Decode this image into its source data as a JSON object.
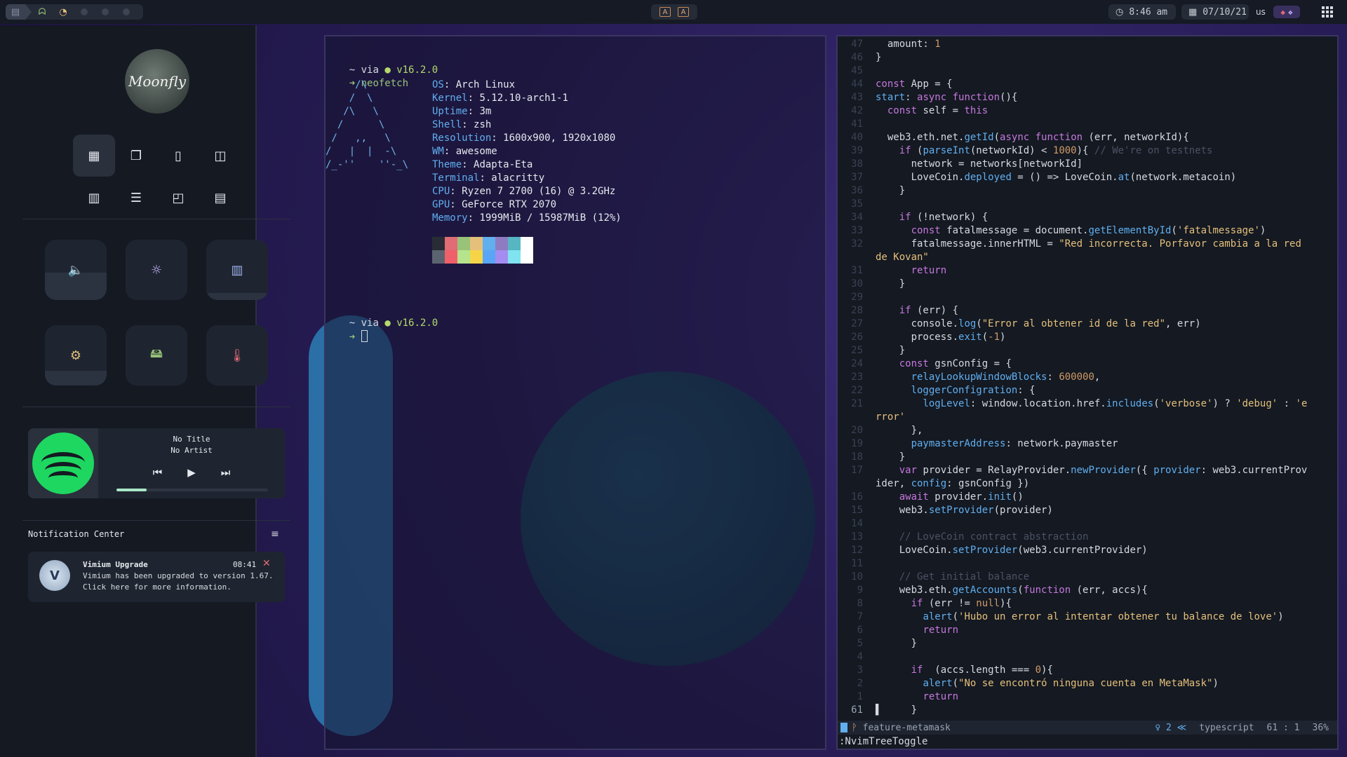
{
  "topbar": {
    "time": "8:46 am",
    "date": "07/10/21",
    "keyboard_layout": "us"
  },
  "sidebar": {
    "avatar_text": "Moonfly",
    "layouts": [
      "tile",
      "floating",
      "max",
      "fair",
      "columns",
      "rows",
      "spiral",
      "dwindle"
    ],
    "tiles": [
      {
        "name": "volume",
        "level": 0.45,
        "icon": "🔈"
      },
      {
        "name": "brightness",
        "level": 0.0,
        "icon": "☼"
      },
      {
        "name": "memory",
        "level": 0.12,
        "icon": "▥"
      },
      {
        "name": "cpu",
        "level": 0.25,
        "icon": "⚙"
      },
      {
        "name": "disk",
        "level": 0.0,
        "icon": "🖴"
      },
      {
        "name": "temperature",
        "level": 0.0,
        "icon": "🌡"
      }
    ],
    "music": {
      "title": "No Title",
      "artist": "No Artist",
      "progress": 0.2
    },
    "notifications": {
      "header": "Notification Center",
      "items": [
        {
          "title": "Vimium Upgrade",
          "time": "08:41",
          "body_line1": "Vimium has been upgraded to version 1.67.",
          "body_line2": "Click here for more information."
        }
      ]
    }
  },
  "terminal": {
    "prompt1_dir": "~",
    "prompt1_via": "via",
    "node_version": "v16.2.0",
    "command": "neofetch",
    "ascii_art": "     /\\\n    /  \\\n   /\\   \\\n  /      \\\n /   ,,   \\\n/   |  |  -\\\n/_-''    ''-_\\",
    "info": [
      {
        "key": "OS",
        "value": "Arch Linux"
      },
      {
        "key": "Kernel",
        "value": "5.12.10-arch1-1"
      },
      {
        "key": "Uptime",
        "value": "3m"
      },
      {
        "key": "Shell",
        "value": "zsh"
      },
      {
        "key": "Resolution",
        "value": "1600x900, 1920x1080"
      },
      {
        "key": "WM",
        "value": "awesome"
      },
      {
        "key": "Theme",
        "value": "Adapta-Eta"
      },
      {
        "key": "Terminal",
        "value": "alacritty"
      },
      {
        "key": "CPU",
        "value": "Ryzen 7 2700 (16) @ 3.2GHz"
      },
      {
        "key": "GPU",
        "value": "GeForce RTX 2070"
      },
      {
        "key": "Memory",
        "value": "1999MiB / 15987MiB (12%)"
      }
    ],
    "palette_top": [
      "#282c34",
      "#e06c75",
      "#98c379",
      "#e5c07b",
      "#61afef",
      "#8e7cc3",
      "#56b6c2",
      "#ffffff"
    ],
    "palette_bottom": [
      "#5c6370",
      "#f0606a",
      "#b5e48c",
      "#f5d547",
      "#58a6f5",
      "#a48cf0",
      "#7fe3f0",
      "#ffffff"
    ]
  },
  "editor": {
    "lines": [
      {
        "n": "47",
        "t": "  amount: <n>1</n>"
      },
      {
        "n": "46",
        "t": "}"
      },
      {
        "n": "45",
        "t": ""
      },
      {
        "n": "44",
        "t": "<k>const</k> App = {"
      },
      {
        "n": "43",
        "t": "<f>start</f>: <k>async</k> <k>function</k>(){"
      },
      {
        "n": "42",
        "t": "  <k>const</k> self = <k>this</k>"
      },
      {
        "n": "41",
        "t": ""
      },
      {
        "n": "40",
        "t": "  web3.eth.net.<f>getId</f>(<k>async</k> <k>function</k> (err, networkId){"
      },
      {
        "n": "39",
        "t": "    <k>if</k> (<f>parseInt</f>(networkId) < <n>1000</n>){ <c>// We're on testnets</c>"
      },
      {
        "n": "38",
        "t": "      network = networks[networkId]"
      },
      {
        "n": "37",
        "t": "      LoveCoin.<f>deployed</f> = () => LoveCoin.<f>at</f>(network.metacoin)"
      },
      {
        "n": "36",
        "t": "    }"
      },
      {
        "n": "35",
        "t": ""
      },
      {
        "n": "34",
        "t": "    <k>if</k> (!network) {"
      },
      {
        "n": "33",
        "t": "      <k>const</k> fatalmessage = document.<f>getElementById</f>(<s>'fatalmessage'</s>)"
      },
      {
        "n": "32",
        "t": "      fatalmessage.innerHTML = <s>\"Red incorrecta. Porfavor cambia a la red</s>"
      },
      {
        "n": "",
        "t": "<s>de Kovan\"</s>",
        "cont": true
      },
      {
        "n": "31",
        "t": "      <k>return</k>"
      },
      {
        "n": "30",
        "t": "    }"
      },
      {
        "n": "29",
        "t": ""
      },
      {
        "n": "28",
        "t": "    <k>if</k> (err) {"
      },
      {
        "n": "27",
        "t": "      console.<f>log</f>(<s>\"Error al obtener id de la red\"</s>, err)"
      },
      {
        "n": "26",
        "t": "      process.<f>exit</f>(<n>-1</n>)"
      },
      {
        "n": "25",
        "t": "    }"
      },
      {
        "n": "24",
        "t": "    <k>const</k> gsnConfig = {"
      },
      {
        "n": "23",
        "t": "      <f>relayLookupWindowBlocks</f>: <n>600000</n>,"
      },
      {
        "n": "22",
        "t": "      <f>loggerConfigration</f>: {"
      },
      {
        "n": "21",
        "t": "        <f>logLevel</f>: window.location.href.<f>includes</f>(<s>'verbose'</s>) ? <s>'debug'</s> : <s>'e</s>"
      },
      {
        "n": "",
        "t": "<s>rror'</s>",
        "cont": true
      },
      {
        "n": "20",
        "t": "      },"
      },
      {
        "n": "19",
        "t": "      <f>paymasterAddress</f>: network.paymaster"
      },
      {
        "n": "18",
        "t": "    }"
      },
      {
        "n": "17",
        "t": "    <k>var</k> provider = RelayProvider.<f>newProvider</f>({ <f>provider</f>: web3.currentProv"
      },
      {
        "n": "",
        "t": "ider, <f>config</f>: gsnConfig })",
        "cont": true
      },
      {
        "n": "16",
        "t": "    <k>await</k> provider.<f>init</f>()"
      },
      {
        "n": "15",
        "t": "    web3.<f>setProvider</f>(provider)"
      },
      {
        "n": "14",
        "t": ""
      },
      {
        "n": "13",
        "t": "    <c>// LoveCoin contract abstraction</c>"
      },
      {
        "n": "12",
        "t": "    LoveCoin.<f>setProvider</f>(web3.currentProvider)"
      },
      {
        "n": "11",
        "t": ""
      },
      {
        "n": "10",
        "t": "    <c>// Get initial balance</c>"
      },
      {
        "n": "9",
        "t": "    web3.eth.<f>getAccounts</f>(<k>function</k> (err, accs){"
      },
      {
        "n": "8",
        "t": "      <k>if</k> (err != <n>null</n>){"
      },
      {
        "n": "7",
        "t": "        <f>alert</f>(<s>'Hubo un error al intentar obtener tu balance de love'</s>)"
      },
      {
        "n": "6",
        "t": "        <k>return</k>"
      },
      {
        "n": "5",
        "t": "      }"
      },
      {
        "n": "4",
        "t": ""
      },
      {
        "n": "3",
        "t": "      <k>if</k>  (accs.length === <n>0</n>){"
      },
      {
        "n": "2",
        "t": "        <f>alert</f>(<s>\"No se encontró ninguna cuenta en MetaMask\"</s>)"
      },
      {
        "n": "1",
        "t": "        <k>return</k>"
      },
      {
        "n": "61",
        "t": "▌     }"
      }
    ],
    "status": {
      "branch": "feature-metamask",
      "lsp": "♀ 2 ≪",
      "filetype": "typescript",
      "position": "61 : 1",
      "percent": "36%"
    },
    "cmdline": ":NvimTreeToggle"
  }
}
